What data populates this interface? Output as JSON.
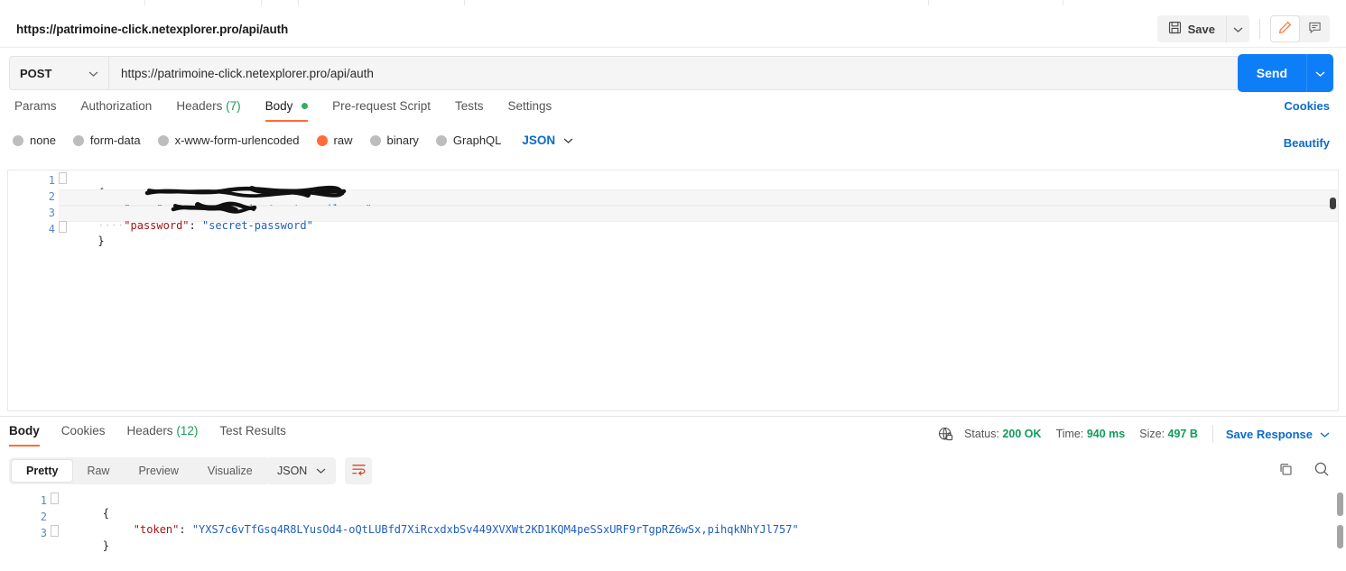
{
  "header": {
    "request_title": "https://patrimoine-click.netexplorer.pro/api/auth",
    "save_label": "Save",
    "save_icon": "floppy-disk-icon",
    "save_caret_icon": "chevron-down-icon",
    "edit_icon": "pencil-icon",
    "comment_icon": "comment-icon"
  },
  "url_bar": {
    "method": "POST",
    "method_caret_icon": "chevron-down-icon",
    "url": "https://patrimoine-click.netexplorer.pro/api/auth",
    "send_label": "Send",
    "send_caret_icon": "chevron-down-icon"
  },
  "request_tabs": {
    "items": [
      {
        "label": "Params",
        "count": "",
        "active": false,
        "dot": false
      },
      {
        "label": "Authorization",
        "count": "",
        "active": false,
        "dot": false
      },
      {
        "label": "Headers",
        "count": "(7)",
        "active": false,
        "dot": false
      },
      {
        "label": "Body",
        "count": "",
        "active": true,
        "dot": true
      },
      {
        "label": "Pre-request Script",
        "count": "",
        "active": false,
        "dot": false
      },
      {
        "label": "Tests",
        "count": "",
        "active": false,
        "dot": false
      },
      {
        "label": "Settings",
        "count": "",
        "active": false,
        "dot": false
      }
    ],
    "cookies_link": "Cookies"
  },
  "body_mode": {
    "options": [
      {
        "label": "none",
        "selected": false
      },
      {
        "label": "form-data",
        "selected": false
      },
      {
        "label": "x-www-form-urlencoded",
        "selected": false
      },
      {
        "label": "raw",
        "selected": true
      },
      {
        "label": "binary",
        "selected": false
      },
      {
        "label": "GraphQL",
        "selected": false
      }
    ],
    "format": "JSON",
    "format_caret_icon": "chevron-down-icon",
    "beautify_label": "Beautify"
  },
  "request_body": {
    "line_numbers": [
      "1",
      "2",
      "3",
      "4"
    ],
    "lines": [
      {
        "text": "{",
        "type": "plain"
      },
      {
        "indent": "····",
        "key": "\"user\"",
        "colon": ": ",
        "value": "\"sylvain.krier@protonmail.com\"",
        "comma": ",",
        "redacted": true
      },
      {
        "indent": "····",
        "key": "\"password\"",
        "colon": ": ",
        "value": "\"secret-password\"",
        "comma": "",
        "redacted": true
      },
      {
        "text": "}",
        "type": "plain"
      }
    ]
  },
  "response_tabs": {
    "items": [
      {
        "label": "Body",
        "count": "",
        "active": true
      },
      {
        "label": "Cookies",
        "count": "",
        "active": false
      },
      {
        "label": "Headers",
        "count": "(12)",
        "active": false
      },
      {
        "label": "Test Results",
        "count": "",
        "active": false
      }
    ]
  },
  "response_meta": {
    "network_icon": "globe-lock-icon",
    "status_label": "Status:",
    "status_value": "200 OK",
    "time_label": "Time:",
    "time_value": "940 ms",
    "size_label": "Size:",
    "size_value": "497 B",
    "save_response_label": "Save Response",
    "save_response_caret_icon": "chevron-down-icon"
  },
  "response_viewbar": {
    "segments": [
      {
        "label": "Pretty",
        "active": true
      },
      {
        "label": "Raw",
        "active": false
      },
      {
        "label": "Preview",
        "active": false
      },
      {
        "label": "Visualize",
        "active": false
      }
    ],
    "format": "JSON",
    "format_caret_icon": "chevron-down-icon",
    "wrap_icon": "wrap-lines-icon",
    "copy_icon": "copy-icon",
    "search_icon": "search-icon"
  },
  "response_body": {
    "line_numbers": [
      "1",
      "2",
      "3"
    ],
    "open_brace": "{",
    "token_key": "\"token\"",
    "token_colon": ": ",
    "token_value": "\"YXS7c6vTfGsq4R8LYusOd4-oQtLUBfd7XiRcxdxbSv449XVXWt2KD1KQM4peSSxURF9rTgpRZ6wSx,pihqkNhYJl757\"",
    "close_brace": "}"
  },
  "colors": {
    "accent_orange": "#ff6c37",
    "link_blue": "#0b6bcb",
    "send_blue": "#0d7ef7",
    "status_green": "#0f9d58",
    "json_key_red": "#a31515",
    "json_string_blue": "#1f5fbf"
  }
}
